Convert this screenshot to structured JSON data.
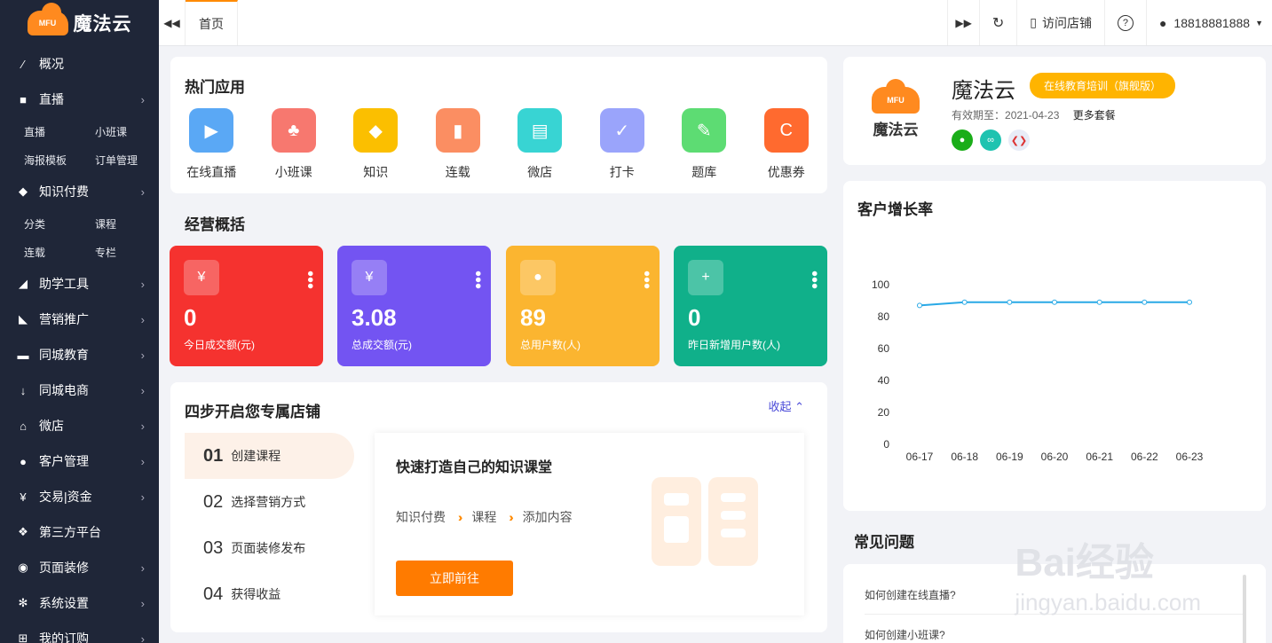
{
  "sidebar": {
    "logo_badge": "MFU",
    "logo_text": "魔法云",
    "items": [
      {
        "label": "概况",
        "icon": "chart-line-icon",
        "has_children": false
      },
      {
        "label": "直播",
        "icon": "video-camera-icon",
        "has_children": true,
        "sub": [
          "直播",
          "小班课",
          "海报模板",
          "订单管理"
        ]
      },
      {
        "label": "知识付费",
        "icon": "graduation-cap-icon",
        "has_children": true,
        "sub": [
          "分类",
          "课程",
          "连载",
          "专栏"
        ]
      },
      {
        "label": "助学工具",
        "icon": "eraser-icon",
        "has_children": true
      },
      {
        "label": "营销推广",
        "icon": "bullhorn-icon",
        "has_children": true
      },
      {
        "label": "同城教育",
        "icon": "laptop-icon",
        "has_children": true
      },
      {
        "label": "同城电商",
        "icon": "thermometer-icon",
        "has_children": true
      },
      {
        "label": "微店",
        "icon": "home-icon",
        "has_children": true
      },
      {
        "label": "客户管理",
        "icon": "user-icon",
        "has_children": true
      },
      {
        "label": "交易|资金",
        "icon": "yen-icon",
        "has_children": true
      },
      {
        "label": "第三方平台",
        "icon": "cubes-icon",
        "has_children": false
      },
      {
        "label": "页面装修",
        "icon": "dashboard-icon",
        "has_children": true
      },
      {
        "label": "系统设置",
        "icon": "gear-icon",
        "has_children": true
      },
      {
        "label": "我的订购",
        "icon": "cart-icon",
        "has_children": true
      }
    ]
  },
  "topbar": {
    "tab_home": "首页",
    "visit_store": "访问店铺",
    "help": "?",
    "username": "18818881888"
  },
  "hot_apps": {
    "title": "热门应用",
    "items": [
      {
        "label": "在线直播",
        "color": "#5aa8f5",
        "icon": "live-camera-icon",
        "glyph": "▶"
      },
      {
        "label": "小班课",
        "color": "#f7786f",
        "icon": "class-group-icon",
        "glyph": "♣"
      },
      {
        "label": "知识",
        "color": "#fbbf00",
        "icon": "graduation-cap-icon",
        "glyph": "◆"
      },
      {
        "label": "连载",
        "color": "#fb8e62",
        "icon": "book-icon",
        "glyph": "▮"
      },
      {
        "label": "微店",
        "color": "#38d4d3",
        "icon": "shop-icon",
        "glyph": "▤"
      },
      {
        "label": "打卡",
        "color": "#9aa4fb",
        "icon": "calendar-check-icon",
        "glyph": "✓"
      },
      {
        "label": "题库",
        "color": "#5ddc73",
        "icon": "edit-icon",
        "glyph": "✎"
      },
      {
        "label": "优惠券",
        "color": "#ff6a2f",
        "icon": "coupon-icon",
        "glyph": "C"
      }
    ]
  },
  "overview": {
    "title": "经营概括",
    "stats": [
      {
        "value": "0",
        "label": "今日成交额(元)",
        "color": "#f5322f",
        "icon": "money-bag-icon",
        "glyph": "¥"
      },
      {
        "value": "3.08",
        "label": "总成交额(元)",
        "color": "#7354f2",
        "icon": "yen-coin-icon",
        "glyph": "¥"
      },
      {
        "value": "89",
        "label": "总用户数(人)",
        "color": "#fbb530",
        "icon": "user-icon",
        "glyph": "●"
      },
      {
        "value": "0",
        "label": "昨日新增用户数(人)",
        "color": "#10b08a",
        "icon": "user-add-icon",
        "glyph": "+"
      }
    ]
  },
  "steps": {
    "title": "四步开启您专属店铺",
    "collapse": "收起",
    "items": [
      {
        "num": "01",
        "label": "创建课程"
      },
      {
        "num": "02",
        "label": "选择营销方式"
      },
      {
        "num": "03",
        "label": "页面装修发布"
      },
      {
        "num": "04",
        "label": "获得收益"
      }
    ],
    "panel_title": "快速打造自己的知识课堂",
    "flow": [
      "知识付费",
      "课程",
      "添加内容"
    ],
    "cta": "立即前往"
  },
  "store": {
    "logo_badge": "MFU",
    "logo_text": "魔法云",
    "name": "魔法云",
    "plan": "在线教育培训（旗舰版）",
    "expire_label": "有效期至：",
    "expire_date": "2021-04-23",
    "more": "更多套餐"
  },
  "growth": {
    "title": "客户增长率"
  },
  "chart_data": {
    "type": "line",
    "title": "客户增长率",
    "categories": [
      "06-17",
      "06-18",
      "06-19",
      "06-20",
      "06-21",
      "06-22",
      "06-23"
    ],
    "values": [
      87,
      89,
      89,
      89,
      89,
      89,
      89
    ],
    "yticks": [
      0,
      20,
      40,
      60,
      80,
      100
    ],
    "ylim": [
      0,
      100
    ],
    "color": "#29a9e6",
    "grid": false
  },
  "faq": {
    "title": "常见问题",
    "items": [
      "如何创建在线直播?",
      "如何创建小班课?"
    ]
  },
  "watermark": {
    "brand": "Bai经验",
    "url": "jingyan.baidu.com"
  }
}
